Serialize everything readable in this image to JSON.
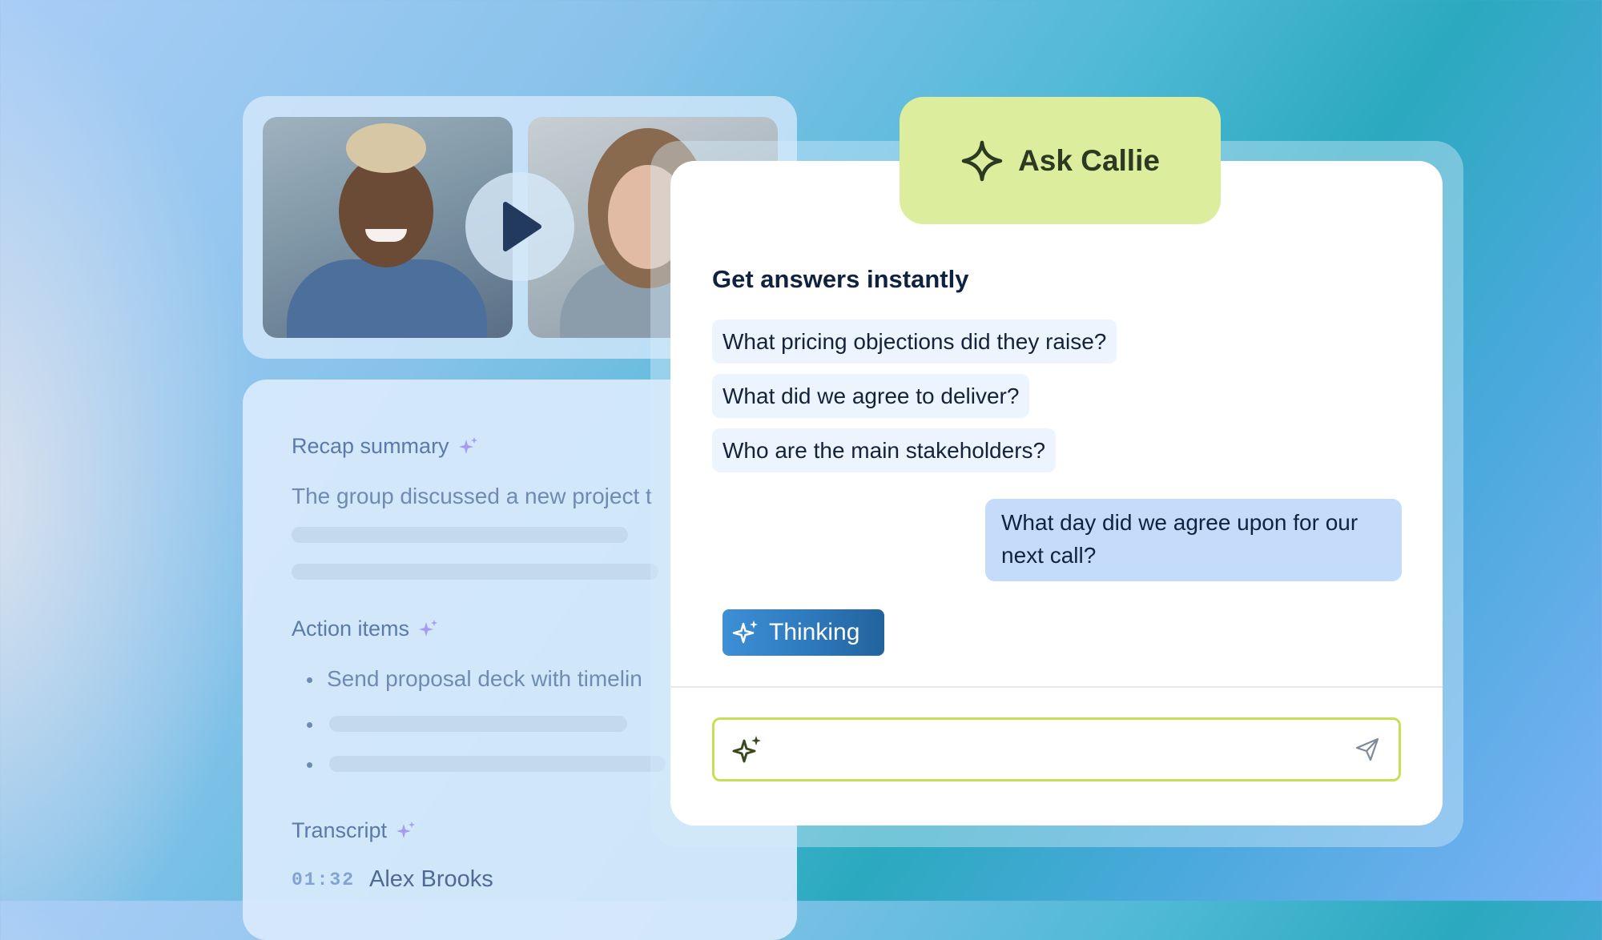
{
  "video": {
    "participants": [
      {
        "name": "participant-1"
      },
      {
        "name": "participant-2"
      }
    ],
    "play_icon": "play-icon"
  },
  "recap": {
    "summary_title": "Recap summary",
    "summary_text": "The group discussed a new project t",
    "action_title": "Action items",
    "action_first": "Send proposal deck with timelin",
    "transcript_title": "Transcript",
    "transcript_time": "01:32",
    "transcript_speaker": "Alex Brooks"
  },
  "chat": {
    "tab_label": "Ask Callie",
    "heading": "Get answers instantly",
    "suggestions": [
      "What pricing objections did they raise?",
      "What did we agree to deliver?",
      "Who are the main stakeholders?"
    ],
    "user_message": "What day did we agree upon for our next call?",
    "thinking_label": "Thinking",
    "input_value": "",
    "input_placeholder": ""
  },
  "colors": {
    "tab_bg": "#dcee9e",
    "input_border": "#c8df55",
    "user_bubble": "#c4dcfa",
    "thinking_start": "#3d8fd6",
    "thinking_end": "#22639d",
    "chip_bg": "#ecf4fd"
  }
}
